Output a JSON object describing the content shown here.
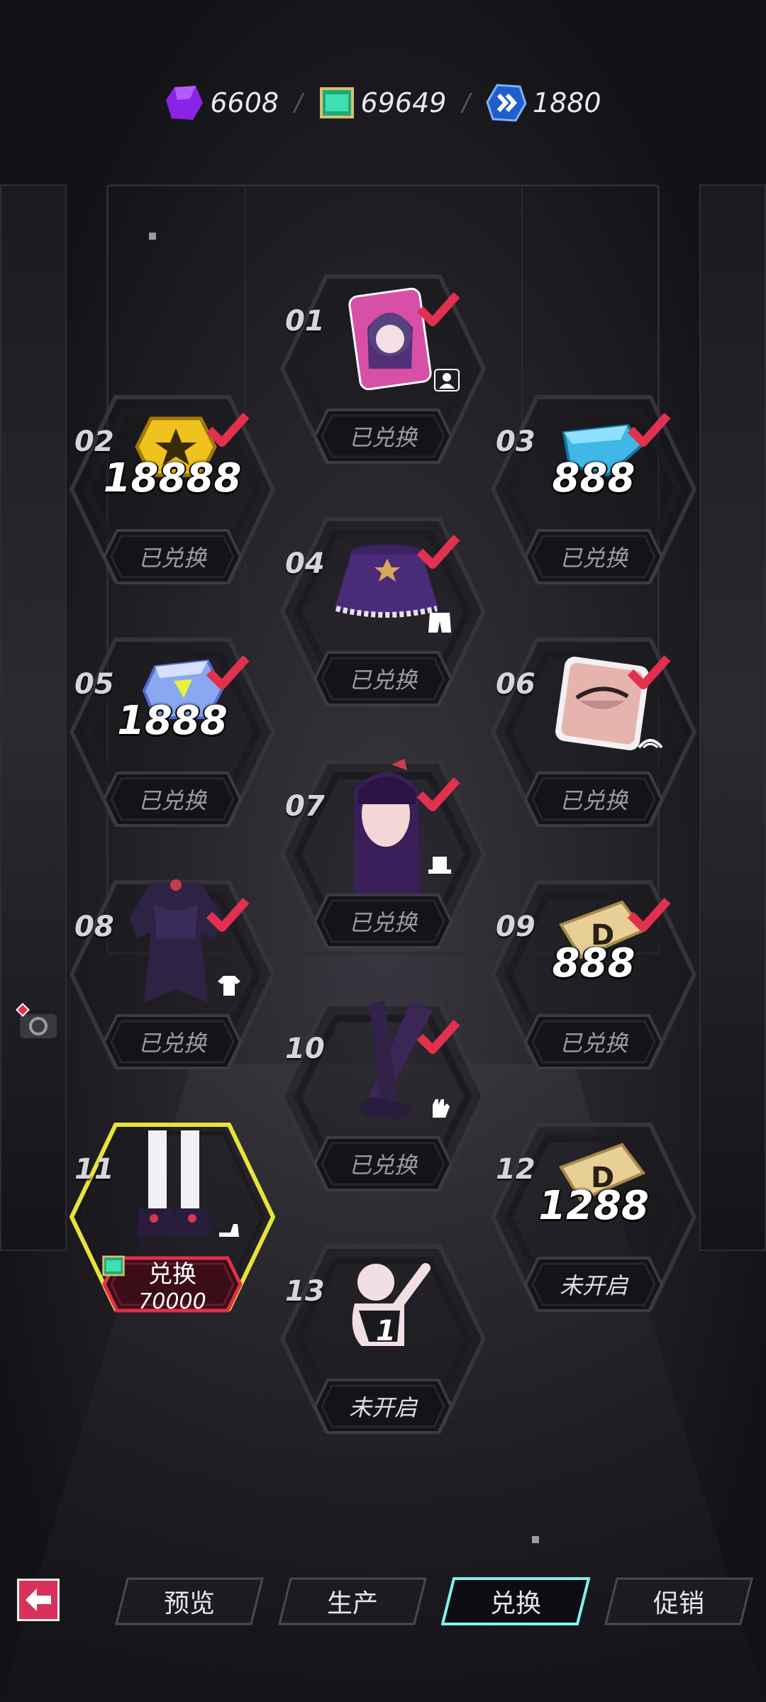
{
  "currencies": [
    {
      "name": "purple-crystal",
      "value": "6608",
      "color": "#9b2cff"
    },
    {
      "name": "green-scroll",
      "value": "69649",
      "color": "#2fd9a3"
    },
    {
      "name": "blue-badge",
      "value": "1880",
      "color": "#2f7cff"
    }
  ],
  "separator": "/",
  "items": [
    {
      "num": "01",
      "status": "已兑换",
      "amount": "",
      "art": "portrait-avatar",
      "type_icon": "person-icon",
      "checked": true
    },
    {
      "num": "02",
      "status": "已兑换",
      "amount": "18888",
      "art": "gold-coin",
      "type_icon": "",
      "checked": true
    },
    {
      "num": "03",
      "status": "已兑换",
      "amount": "888",
      "art": "blue-diamond",
      "type_icon": "",
      "checked": true
    },
    {
      "num": "04",
      "status": "已兑换",
      "amount": "",
      "art": "purple-skirt",
      "type_icon": "shorts-icon",
      "checked": true
    },
    {
      "num": "05",
      "status": "已兑换",
      "amount": "1888",
      "art": "crystal-gem",
      "type_icon": "",
      "checked": true
    },
    {
      "num": "06",
      "status": "已兑换",
      "amount": "",
      "art": "eyeshadow-makeup",
      "type_icon": "eye-icon",
      "checked": true
    },
    {
      "num": "07",
      "status": "已兑换",
      "amount": "",
      "art": "hair-headpiece",
      "type_icon": "hat-icon",
      "checked": true
    },
    {
      "num": "08",
      "status": "已兑换",
      "amount": "",
      "art": "dress-top",
      "type_icon": "shirt-icon",
      "checked": true
    },
    {
      "num": "09",
      "status": "已兑换",
      "amount": "888",
      "art": "d-ticket",
      "type_icon": "",
      "checked": true
    },
    {
      "num": "10",
      "status": "已兑换",
      "amount": "",
      "art": "long-gloves",
      "type_icon": "glove-icon",
      "checked": true
    },
    {
      "num": "11",
      "status": "兑换",
      "amount": "",
      "art": "stockings-shoes",
      "type_icon": "shoe-icon",
      "checked": false,
      "cost": "70000"
    },
    {
      "num": "12",
      "status": "未开启",
      "amount": "1288",
      "art": "d-ticket",
      "type_icon": "",
      "checked": false
    },
    {
      "num": "13",
      "status": "未开启",
      "amount": "",
      "art": "pose-figure",
      "type_icon": "",
      "checked": false
    }
  ],
  "nav": {
    "tabs": [
      "预览",
      "生产",
      "兑换",
      "促销"
    ],
    "active_tab": "兑换"
  }
}
